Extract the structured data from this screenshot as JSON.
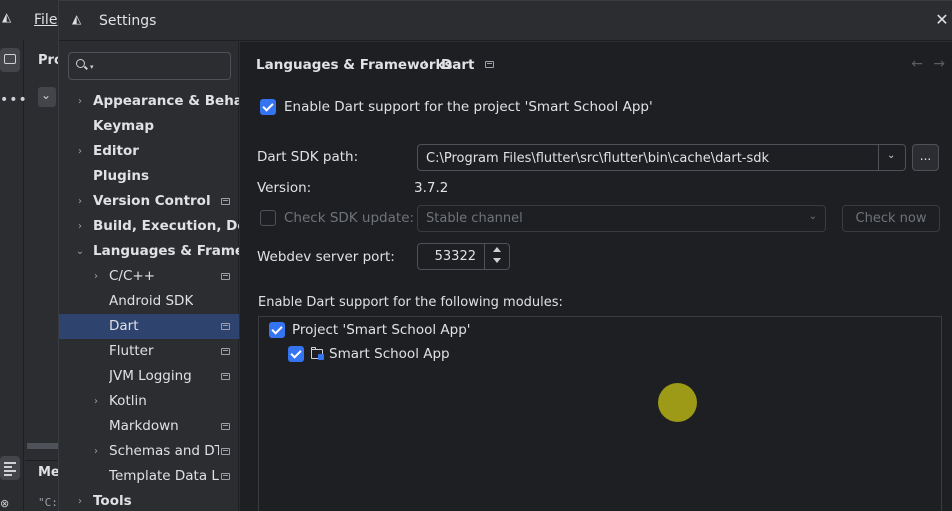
{
  "ide": {
    "menu_file": "File",
    "project_label": "Pro",
    "bottom_label": "Me",
    "bottom_text": "\"C:"
  },
  "dialog": {
    "title": "Settings",
    "search": {
      "placeholder": "",
      "value": ""
    },
    "tree": [
      {
        "label": "Appearance & Behavior",
        "level": 0,
        "chevron": true,
        "expanded": false,
        "bold": true,
        "badge": false
      },
      {
        "label": "Keymap",
        "level": 0,
        "chevron": false,
        "bold": true,
        "badge": false
      },
      {
        "label": "Editor",
        "level": 0,
        "chevron": true,
        "expanded": false,
        "bold": true,
        "badge": false
      },
      {
        "label": "Plugins",
        "level": 0,
        "chevron": false,
        "bold": true,
        "badge": false
      },
      {
        "label": "Version Control",
        "level": 0,
        "chevron": true,
        "expanded": false,
        "bold": true,
        "badge": true
      },
      {
        "label": "Build, Execution, Deployment",
        "level": 0,
        "chevron": true,
        "expanded": false,
        "bold": true,
        "badge": false
      },
      {
        "label": "Languages & Frameworks",
        "level": 0,
        "chevron": true,
        "expanded": true,
        "bold": true,
        "badge": false
      },
      {
        "label": "C/C++",
        "level": 1,
        "chevron": true,
        "expanded": false,
        "bold": false,
        "badge": true
      },
      {
        "label": "Android SDK",
        "level": 1,
        "chevron": false,
        "bold": false,
        "badge": false
      },
      {
        "label": "Dart",
        "level": 1,
        "chevron": false,
        "bold": false,
        "badge": true,
        "selected": true
      },
      {
        "label": "Flutter",
        "level": 1,
        "chevron": false,
        "bold": false,
        "badge": true
      },
      {
        "label": "JVM Logging",
        "level": 1,
        "chevron": false,
        "bold": false,
        "badge": true
      },
      {
        "label": "Kotlin",
        "level": 1,
        "chevron": true,
        "expanded": false,
        "bold": false,
        "badge": false
      },
      {
        "label": "Markdown",
        "level": 1,
        "chevron": false,
        "bold": false,
        "badge": true
      },
      {
        "label": "Schemas and DTDs",
        "level": 1,
        "chevron": true,
        "expanded": false,
        "bold": false,
        "badge": true
      },
      {
        "label": "Template Data Languages",
        "level": 1,
        "chevron": false,
        "bold": false,
        "badge": true
      },
      {
        "label": "Tools",
        "level": 0,
        "chevron": true,
        "expanded": false,
        "bold": true,
        "badge": false
      }
    ],
    "breadcrumb": {
      "parent": "Languages & Frameworks",
      "separator": "›",
      "current": "Dart"
    },
    "nav": {
      "back": "←",
      "forward": "→"
    },
    "enable_support": {
      "label": "Enable Dart support for the project 'Smart School App'",
      "checked": true
    },
    "sdk_path": {
      "label": "Dart SDK path:",
      "value": "C:\\Program Files\\flutter\\src\\flutter\\bin\\cache\\dart-sdk",
      "browse_label": "..."
    },
    "version": {
      "label": "Version:",
      "value": "3.7.2"
    },
    "check_update": {
      "label": "Check SDK update:",
      "checked": false,
      "channel": "Stable channel",
      "button_label": "Check now"
    },
    "webdev_port": {
      "label": "Webdev server port:",
      "value": "53322"
    },
    "modules": {
      "label": "Enable Dart support for the following modules:",
      "project": {
        "label": "Project 'Smart School App'",
        "checked": true
      },
      "module": {
        "label": "Smart School App",
        "checked": true
      }
    }
  },
  "colors": {
    "accent": "#3574f0",
    "selection": "#2e436e",
    "cursor_dot": "#9c9a16"
  }
}
